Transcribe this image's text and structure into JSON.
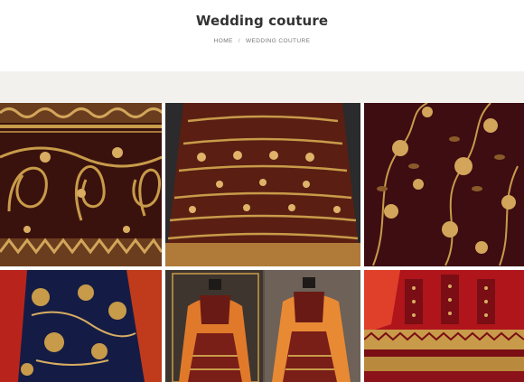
{
  "page": {
    "title": "Wedding couture"
  },
  "breadcrumb": {
    "home_label": "HOME",
    "separator": "/",
    "current_label": "WEDDING COUTURE"
  },
  "gallery": {
    "items": [
      {
        "subject": "gold embroidery on maroon velvet"
      },
      {
        "subject": "gold embroidered lehenga skirt"
      },
      {
        "subject": "gold floral vine embroidery on maroon"
      },
      {
        "subject": "navy and gold embroidered fabric"
      },
      {
        "subject": "orange lehengas on mannequins"
      },
      {
        "subject": "red and gold lehenga skirt"
      }
    ]
  },
  "colors": {
    "title": "#333333",
    "breadcrumb": "#777777",
    "band": "#f3f1ee",
    "maroon": "#3a0f0c",
    "gold": "#c89b4a",
    "navy": "#141c45",
    "orange": "#e07a2a",
    "red": "#a3141b"
  }
}
